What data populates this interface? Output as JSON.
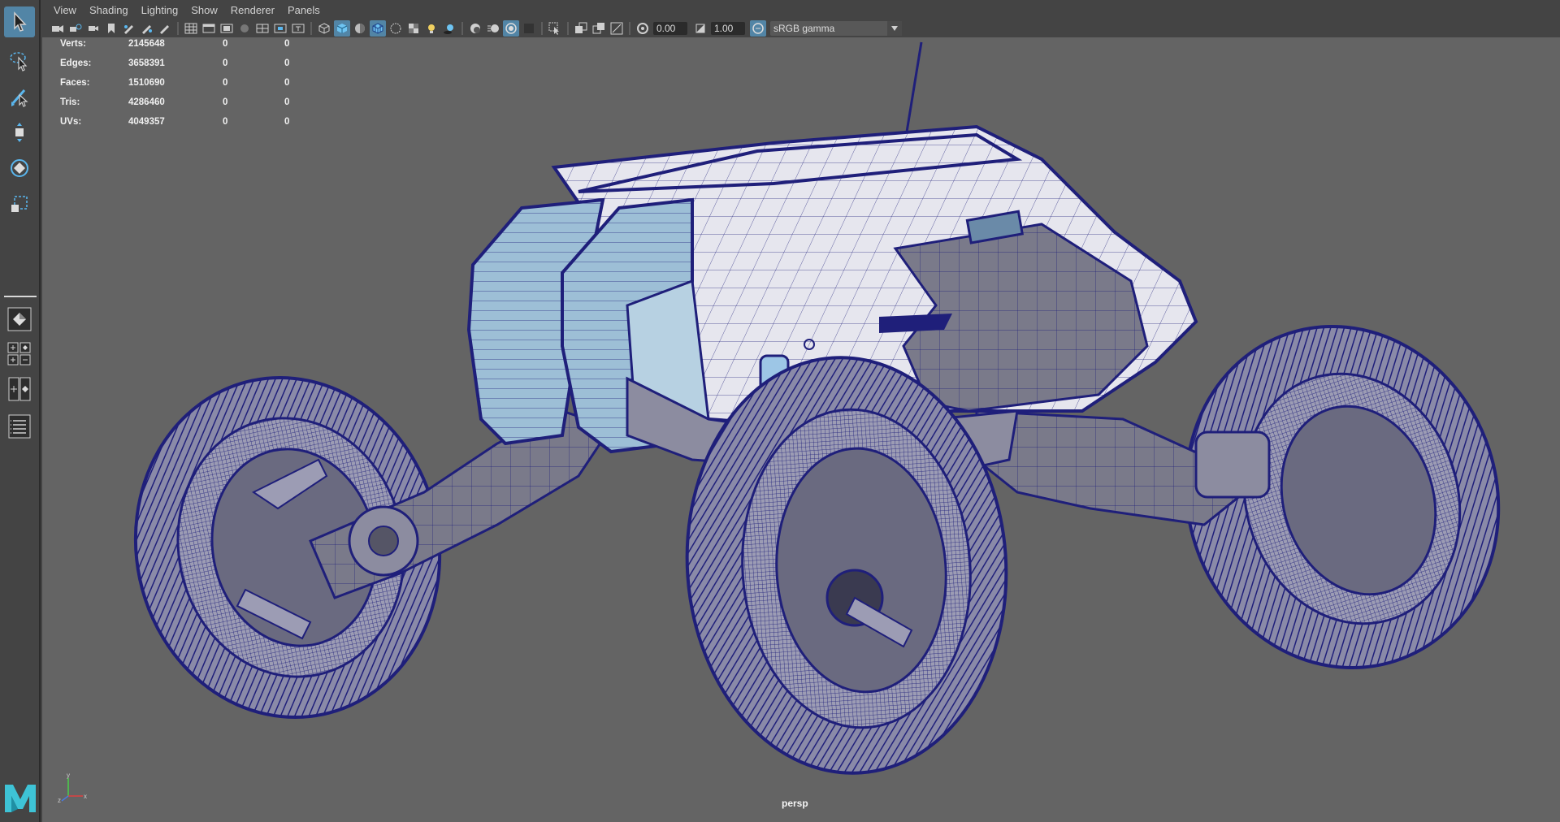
{
  "menu": [
    "View",
    "Shading",
    "Lighting",
    "Show",
    "Renderer",
    "Panels"
  ],
  "toolbar": {
    "near_clip": "0.00",
    "gain": "1.00",
    "color_management": "sRGB gamma"
  },
  "hud": {
    "rows": [
      {
        "label": "Verts:",
        "values": [
          "2145648",
          "0",
          "0"
        ]
      },
      {
        "label": "Edges:",
        "values": [
          "3658391",
          "0",
          "0"
        ]
      },
      {
        "label": "Faces:",
        "values": [
          "1510690",
          "0",
          "0"
        ]
      },
      {
        "label": "Tris:",
        "values": [
          "4286460",
          "0",
          "0"
        ]
      },
      {
        "label": "UVs:",
        "values": [
          "4049357",
          "0",
          "0"
        ]
      }
    ]
  },
  "camera": "persp",
  "axis": {
    "x": "x",
    "y": "y",
    "z": "z"
  },
  "colors": {
    "viewport_bg": "#646464",
    "wire": "#1f1f7a",
    "accent": "#5285a6",
    "maya_logo": "#3ec3d6"
  },
  "scene_icons": [
    "rover-model-wireframe"
  ]
}
